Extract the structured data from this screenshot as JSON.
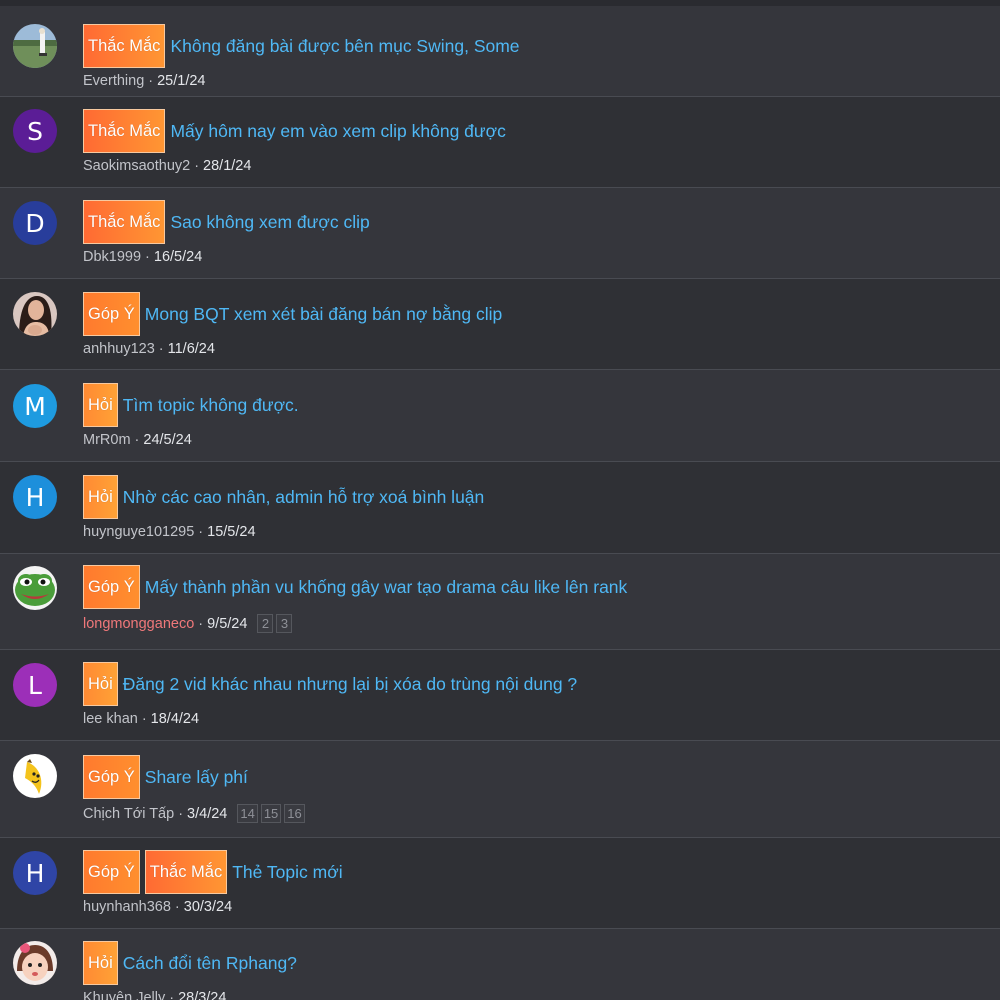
{
  "colors": {
    "background": "#2f3035",
    "row_alt": "#35363c",
    "title_link": "#4fb8f5",
    "prefix_orange": "#ff8a33",
    "special_author": "#f0787a"
  },
  "threads": [
    {
      "prefixes": [
        "Thắc Mắc"
      ],
      "title": "Không đăng bài được bên mục Swing, Some",
      "author": "Everthing",
      "date": "25/1/24",
      "avatar": {
        "type": "image",
        "icon": "golf-photo-avatar"
      },
      "pages": []
    },
    {
      "prefixes": [
        "Thắc Mắc"
      ],
      "title": "Mấy hôm nay em vào xem clip không được",
      "author": "Saokimsaothuy2",
      "date": "28/1/24",
      "avatar": {
        "type": "letter",
        "letter": "S",
        "color": "#5b1d96"
      },
      "pages": []
    },
    {
      "prefixes": [
        "Thắc Mắc"
      ],
      "title": "Sao không xem được clip",
      "author": "Dbk1999",
      "date": "16/5/24",
      "avatar": {
        "type": "letter",
        "letter": "D",
        "color": "#283d9b"
      },
      "pages": []
    },
    {
      "prefixes": [
        "Góp Ý"
      ],
      "title": "Mong BQT xem xét bài đăng bán nợ bằng clip",
      "author": "anhhuy123",
      "date": "11/6/24",
      "avatar": {
        "type": "image",
        "icon": "woman-photo-avatar"
      },
      "pages": []
    },
    {
      "prefixes": [
        "Hỏi"
      ],
      "title": "Tìm topic không được.",
      "author": "MrR0m",
      "date": "24/5/24",
      "avatar": {
        "type": "letter",
        "letter": "M",
        "color": "#1e9be0"
      },
      "pages": []
    },
    {
      "prefixes": [
        "Hỏi"
      ],
      "title": "Nhờ các cao nhân, admin hỗ trợ xoá bình luận",
      "author": "huynguye101295",
      "date": "15/5/24",
      "avatar": {
        "type": "letter",
        "letter": "H",
        "color": "#1d8fdb"
      },
      "pages": []
    },
    {
      "prefixes": [
        "Góp Ý"
      ],
      "title": "Mấy thành phần vu khống gây war tạo drama câu like lên rank",
      "author": "longmongganeco",
      "author_special": true,
      "date": "9/5/24",
      "avatar": {
        "type": "image",
        "icon": "frog-avatar"
      },
      "pages": [
        "2",
        "3"
      ]
    },
    {
      "prefixes": [
        "Hỏi"
      ],
      "title": "Đăng 2 vid khác nhau nhưng lại bị xóa do trùng nội dung ?",
      "author": "lee khan",
      "date": "18/4/24",
      "avatar": {
        "type": "letter",
        "letter": "L",
        "color": "#9c2fb8"
      },
      "pages": []
    },
    {
      "prefixes": [
        "Góp Ý"
      ],
      "title": "Share lấy phí",
      "author": "Chịch Tới Tấp",
      "date": "3/4/24",
      "avatar": {
        "type": "image",
        "icon": "banana-avatar"
      },
      "pages": [
        "14",
        "15",
        "16"
      ]
    },
    {
      "prefixes": [
        "Góp Ý",
        "Thắc Mắc"
      ],
      "title": "Thẻ Topic mới",
      "author": "huynhanh368",
      "date": "30/3/24",
      "avatar": {
        "type": "letter",
        "letter": "H",
        "color": "#2f45a6"
      },
      "pages": []
    },
    {
      "prefixes": [
        "Hỏi"
      ],
      "title": "Cách đổi tên Rphang?",
      "author": "Khuyên Jelly",
      "date": "28/3/24",
      "avatar": {
        "type": "image",
        "icon": "cartoon-girl-avatar"
      },
      "pages": []
    }
  ]
}
